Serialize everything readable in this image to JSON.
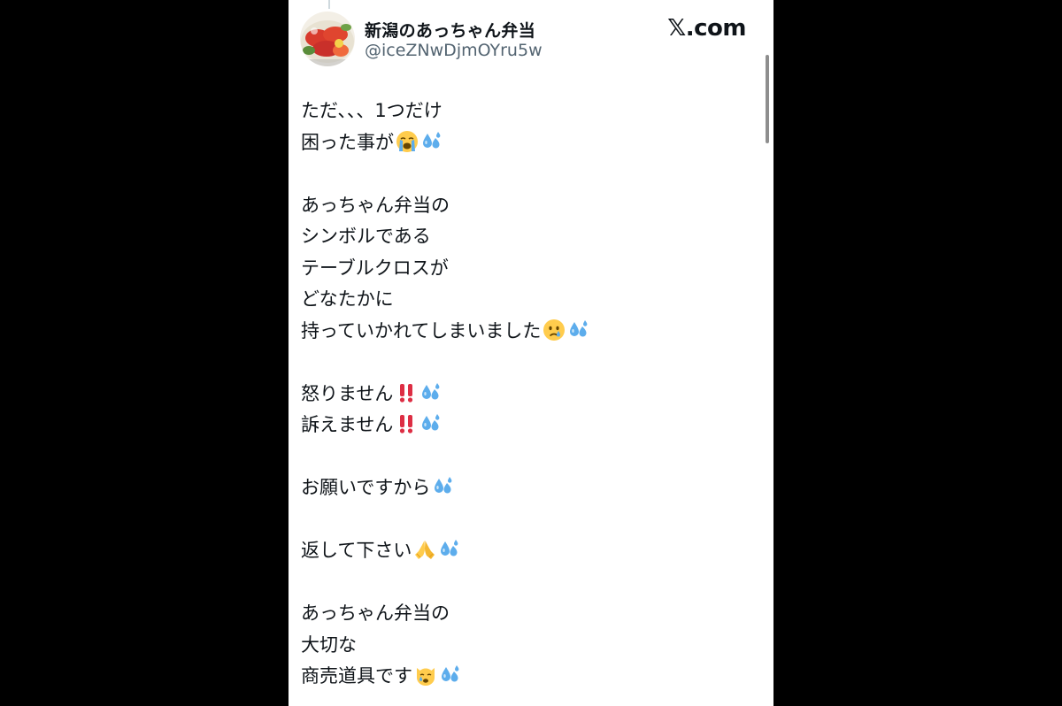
{
  "page": {
    "background": "#000000",
    "panel_background": "#ffffff"
  },
  "header": {
    "display_name": "新潟のあっちゃん弁当",
    "handle": "@iceZNwDjmOYru5w",
    "site_logo": "𝕏.com"
  },
  "post": {
    "lines": [
      {
        "text": "ただ、、、1つだけ",
        "emojis": []
      },
      {
        "text": "困った事が",
        "emojis": [
          "loudly-crying-face-emoji",
          "sweat-droplets-emoji"
        ]
      },
      {
        "text": "",
        "emojis": []
      },
      {
        "text": "あっちゃん弁当の",
        "emojis": []
      },
      {
        "text": "シンボルである",
        "emojis": []
      },
      {
        "text": "テーブルクロスが",
        "emojis": []
      },
      {
        "text": "どなたかに",
        "emojis": []
      },
      {
        "text": "持っていかれてしまいました",
        "emojis": [
          "crying-face-emoji",
          "sweat-droplets-emoji"
        ]
      },
      {
        "text": "",
        "emojis": []
      },
      {
        "text": "怒りません",
        "emojis": [
          "double-exclamation-emoji",
          "sweat-droplets-emoji"
        ]
      },
      {
        "text": "訴えません",
        "emojis": [
          "double-exclamation-emoji",
          "sweat-droplets-emoji"
        ]
      },
      {
        "text": "",
        "emojis": []
      },
      {
        "text": "お願いですから",
        "emojis": [
          "sweat-droplets-emoji"
        ]
      },
      {
        "text": "",
        "emojis": []
      },
      {
        "text": "返して下さい",
        "emojis": [
          "folded-hands-emoji",
          "sweat-droplets-emoji"
        ]
      },
      {
        "text": "",
        "emojis": []
      },
      {
        "text": "あっちゃん弁当の",
        "emojis": []
      },
      {
        "text": "大切な",
        "emojis": []
      },
      {
        "text": "商売道具です",
        "emojis": [
          "crying-cat-face-emoji",
          "sweat-droplets-emoji"
        ]
      }
    ]
  },
  "colors": {
    "text_primary": "#0f1419",
    "text_secondary": "#536471"
  }
}
